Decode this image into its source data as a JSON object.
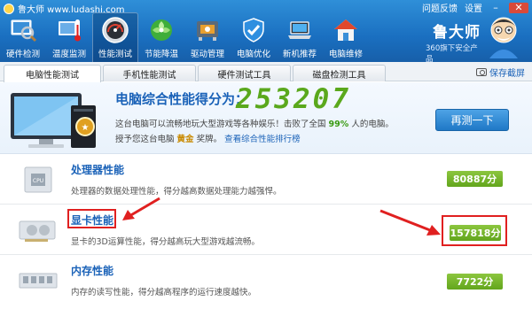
{
  "app": {
    "title": "鲁大师 www.ludashi.com"
  },
  "window": {
    "feedback": "问题反馈",
    "settings": "设置"
  },
  "toolbar": {
    "items": [
      {
        "label": "硬件检测",
        "icon": "monitor-magnifier-icon"
      },
      {
        "label": "温度监测",
        "icon": "thermometer-icon"
      },
      {
        "label": "性能测试",
        "icon": "speedometer-icon",
        "active": true
      },
      {
        "label": "节能降温",
        "icon": "leaf-fan-icon"
      },
      {
        "label": "驱动管理",
        "icon": "chip-gear-icon"
      },
      {
        "label": "电脑优化",
        "icon": "shield-check-icon"
      },
      {
        "label": "新机推荐",
        "icon": "laptop-icon"
      },
      {
        "label": "电脑维修",
        "icon": "house-icon"
      }
    ]
  },
  "brand": {
    "name": "鲁大师",
    "sub": "360旗下安全产品"
  },
  "tabs": [
    {
      "label": "电脑性能测试",
      "active": true
    },
    {
      "label": "手机性能测试"
    },
    {
      "label": "硬件测试工具"
    },
    {
      "label": "磁盘检测工具"
    }
  ],
  "save_screenshot": "保存截屏",
  "score": {
    "label": "电脑综合性能得分为：",
    "value": "253207",
    "desc_prefix": "这台电脑可以流畅地玩大型游戏等各种娱乐！击败了全国",
    "percent": "99%",
    "desc_suffix": "人的电脑。",
    "level_prefix": "授予您这台电脑",
    "level": "黄金",
    "level_suffix": "奖牌。",
    "ranking_link": "查看综合性能排行榜",
    "retest_button": "再测一下"
  },
  "rows": [
    {
      "name": "处理器性能",
      "desc": "处理器的数据处理性能，得分越高数据处理能力越强悍。",
      "score": "80887分",
      "icon": "cpu-icon"
    },
    {
      "name": "显卡性能",
      "desc": "显卡的3D运算性能，得分越高玩大型游戏越流畅。",
      "score": "157818分",
      "icon": "graphics-card-icon"
    },
    {
      "name": "内存性能",
      "desc": "内存的读写性能，得分越高程序的运行速度越快。",
      "score": "7722分",
      "icon": "memory-icon"
    }
  ],
  "colors": {
    "accent": "#1a62b8",
    "score_green": "#5aa81c",
    "highlight_red": "#e02020"
  }
}
